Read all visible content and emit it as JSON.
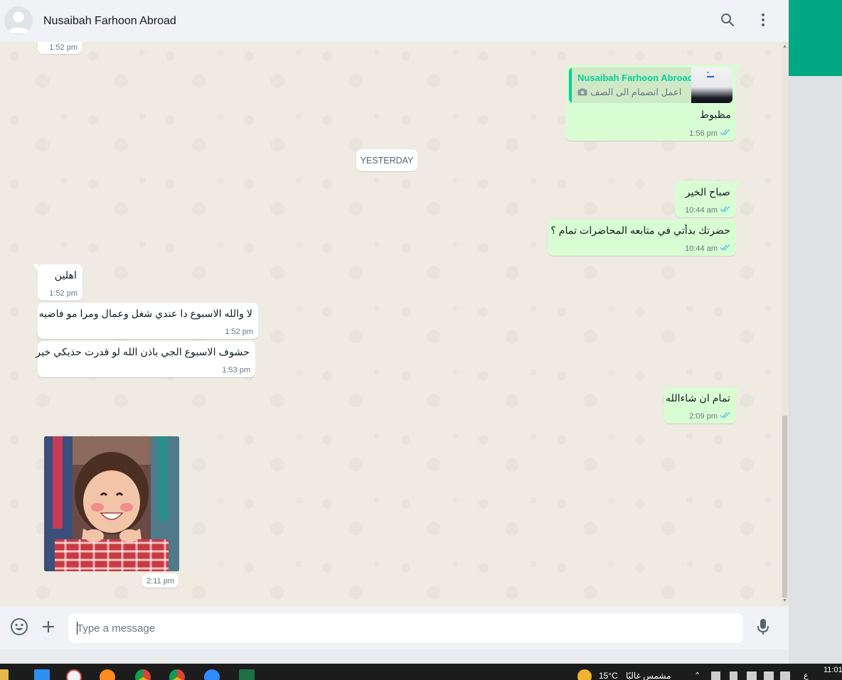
{
  "header": {
    "contact_name": "Nusaibah Farhoon Abroad",
    "icons": [
      "search-icon",
      "menu-dots-icon"
    ]
  },
  "messages": {
    "top_partial_time": "1:52 pm",
    "reply": {
      "quoted_name": "Nusaibah Farhoon Abroad",
      "quoted_text": "اعمل انضمام الى الصف",
      "text": "مظبوط",
      "time": "1:56 pm"
    },
    "date_divider": "YESTERDAY",
    "out1": {
      "text": "صباح الخير",
      "time": "10:44 am"
    },
    "out2": {
      "text": "حضرتك بدأتي في متابعه المحاضرات تمام ؟",
      "time": "10:44 am"
    },
    "in1": {
      "text": "اهلين",
      "time": "1:52 pm"
    },
    "in2": {
      "text": "لا والله الاسبوع دا عندي شغل وعمال ومرا مو فاضيه",
      "time": "1:52 pm"
    },
    "in3": {
      "text": "حشوف الاسبوع الجي باذن الله لو قدرت حذيكي خير",
      "time": "1:53 pm"
    },
    "out3": {
      "text": "تمام ان شاءالله",
      "time": "2:09 pm"
    },
    "photo": {
      "time": "2:11 pm"
    }
  },
  "composer": {
    "placeholder": "Type a message",
    "icons": [
      "emoji-icon",
      "attach-plus-icon",
      "microphone-icon"
    ]
  },
  "taskbar": {
    "weather": "15°C",
    "weather_desc": "مشمس غالبًا",
    "clock": "11:01",
    "lang": "ع"
  },
  "colors": {
    "accent": "#00a884",
    "outgoing_bubble": "#d9fdd3",
    "incoming_bubble": "#ffffff",
    "read_tick": "#53bdeb",
    "chat_bg": "#efeae2"
  }
}
